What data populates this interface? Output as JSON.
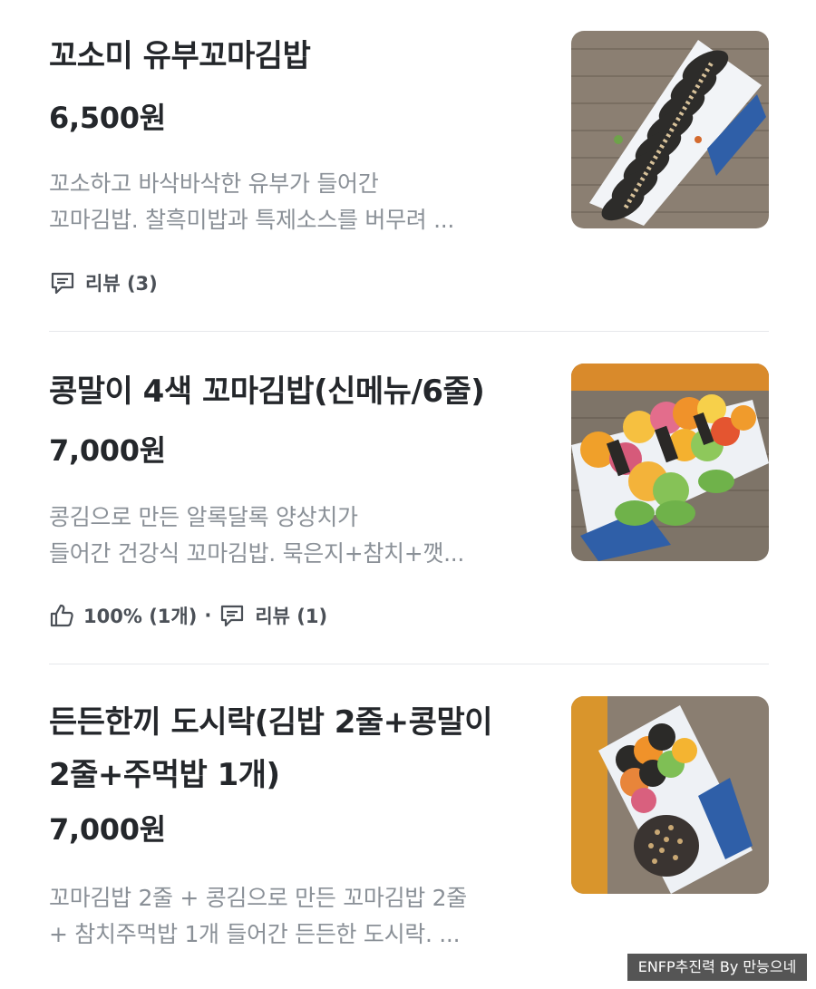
{
  "menu_items": [
    {
      "name": "꼬소미 유부꼬마김밥",
      "price": "6,500원",
      "description_lines": [
        "꼬소하고 바삭바삭한 유부가 들어간",
        "꼬마김밥. 찰흑미밥과 특제소스를 버무려 ..."
      ],
      "review_label": "리뷰 (3)",
      "image": "fried-tofu-kimbap-photo"
    },
    {
      "name": "콩말이 4색 꼬마김밥(신메뉴/6줄)",
      "price": "7,000원",
      "description_lines": [
        "콩김으로 만든 알록달록 양상치가",
        "들어간 건강식 꼬마김밥. 묵은지+참치+깻..."
      ],
      "like_label": "100% (1개)",
      "separator": "·",
      "review_label": "리뷰 (1)",
      "image": "four-color-kimbap-photo"
    },
    {
      "name_lines": [
        "든든한끼 도시락(김밥 2줄+콩말이",
        "2줄+주먹밥 1개)"
      ],
      "price": "7,000원",
      "description_lines": [
        "꼬마김밥 2줄 + 콩김으로 만든 꼬마김밥 2줄",
        "+ 참치주먹밥 1개 들어간 든든한 도시락. ..."
      ],
      "image": "lunchbox-photo"
    }
  ],
  "icons": {
    "review": "comment-icon",
    "like": "thumbs-up-icon"
  },
  "colors": {
    "title": "#24272b",
    "description": "#8a9097",
    "meta": "#4b5057",
    "divider": "#e6e8eb"
  },
  "watermark": "ENFP추진력 By 만능으네"
}
